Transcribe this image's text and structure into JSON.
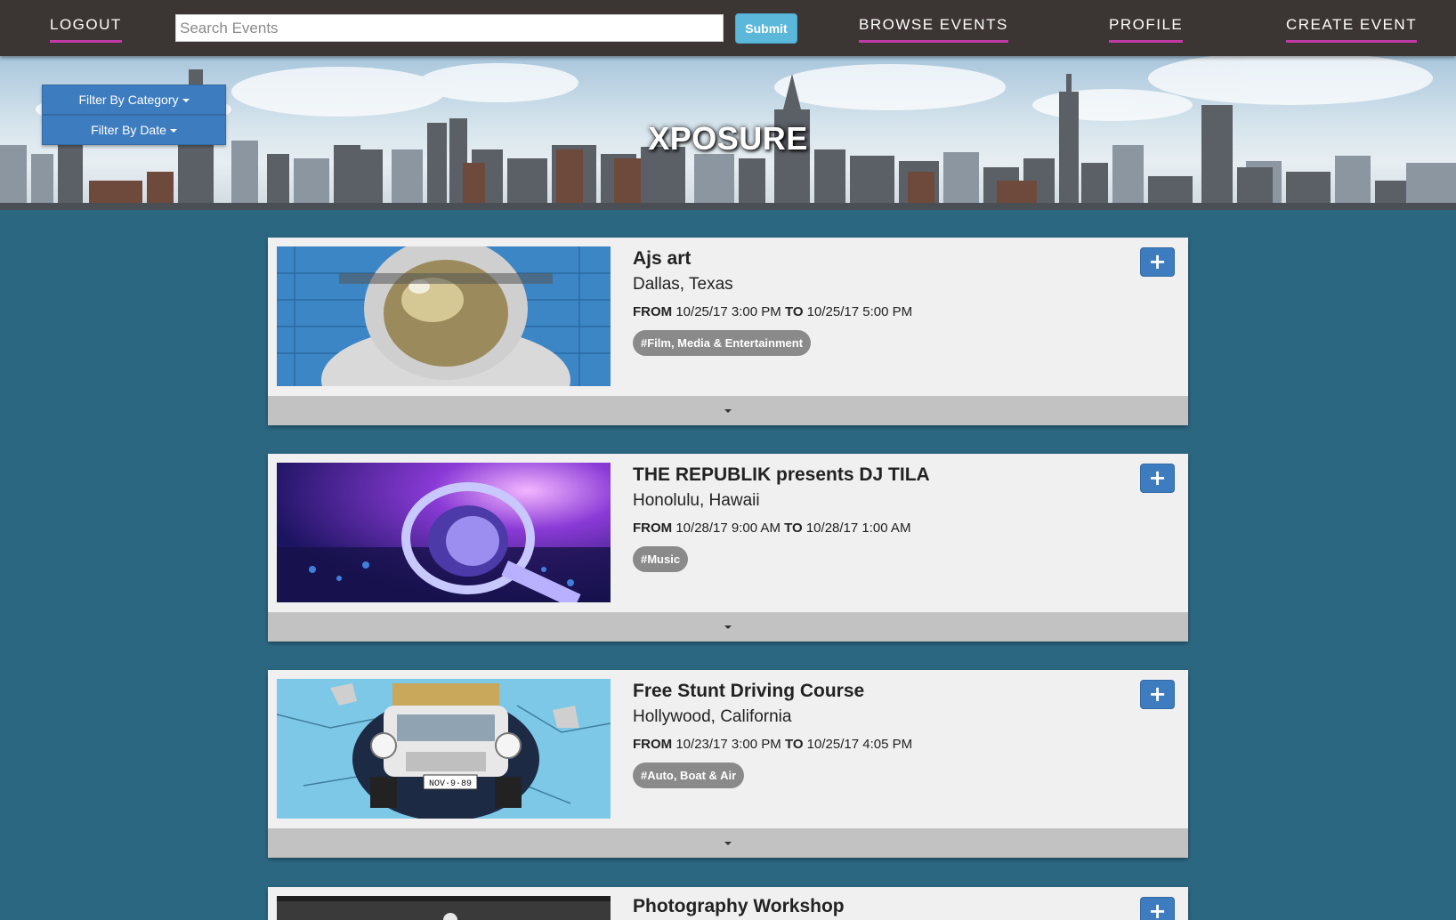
{
  "nav": {
    "logout": "LOGOUT",
    "search_placeholder": "Search Events",
    "submit": "Submit",
    "browse": "BROWSE EVENTS",
    "profile": "PROFILE",
    "create": "CREATE EVENT"
  },
  "hero": {
    "title": "XPOSURE",
    "filter_category": "Filter By Category",
    "filter_date": "Filter By Date"
  },
  "events": [
    {
      "title": "Ajs art",
      "location": "Dallas, Texas",
      "from_label": "FROM",
      "from": "10/25/17 3:00 PM",
      "to_label": "TO",
      "to": "10/25/17 5:00 PM",
      "tag": "#Film, Media & Entertainment",
      "image": "astronaut-mural-image"
    },
    {
      "title": "THE REPUBLIK presents DJ TILA",
      "location": "Honolulu, Hawaii",
      "from_label": "FROM",
      "from": "10/28/17 9:00 AM",
      "to_label": "TO",
      "to": "10/28/17 1:00 AM",
      "tag": "#Music",
      "image": "dj-headphones-image"
    },
    {
      "title": "Free Stunt Driving Course",
      "location": "Hollywood, California",
      "from_label": "FROM",
      "from": "10/23/17 3:00 PM",
      "to_label": "TO",
      "to": "10/25/17 4:05 PM",
      "tag": "#Auto, Boat & Air",
      "image": "car-wall-mural-image",
      "plate": "NOV·9·89"
    },
    {
      "title": "Photography Workshop"
    }
  ],
  "colors": {
    "navbar": "#3b3533",
    "nav_underline": "#c23aa8",
    "page_bg": "#2c6782",
    "primary_button": "#3e7cc0",
    "submit_button": "#5cb8da",
    "card_bg": "#f0f0f0",
    "tag_bg": "#8a8a8a"
  },
  "icons": {
    "add": "plus-icon",
    "expand": "caret-down-icon"
  }
}
